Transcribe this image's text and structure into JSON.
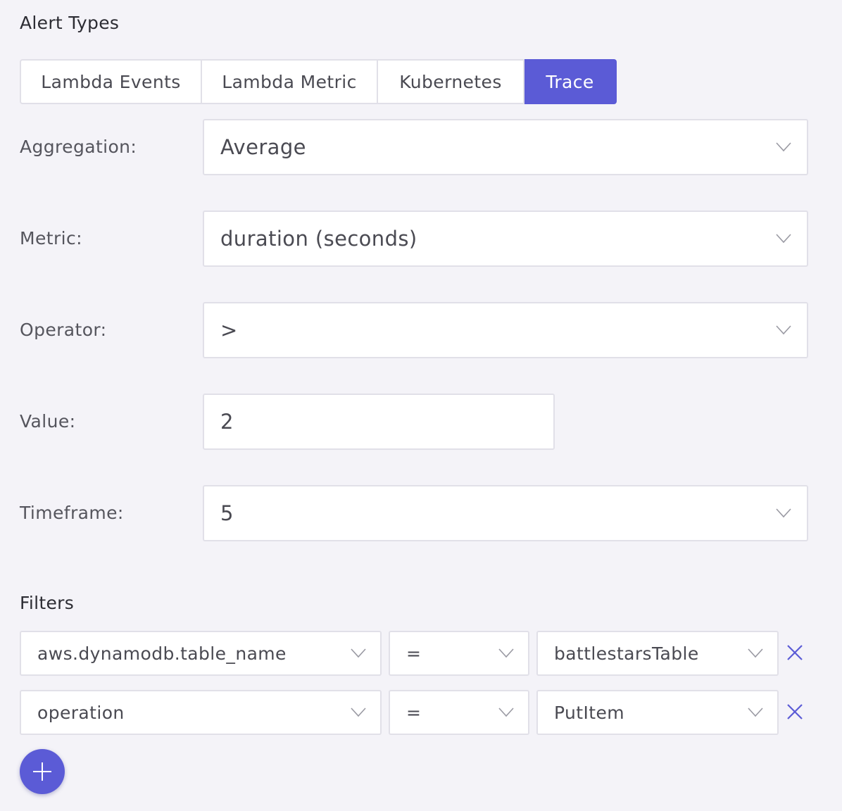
{
  "alert_types": {
    "title": "Alert Types",
    "tabs": [
      {
        "label": "Lambda Events",
        "active": false
      },
      {
        "label": "Lambda Metric",
        "active": false
      },
      {
        "label": "Kubernetes",
        "active": false
      },
      {
        "label": "Trace",
        "active": true
      }
    ]
  },
  "form": {
    "aggregation": {
      "label": "Aggregation:",
      "value": "Average"
    },
    "metric": {
      "label": "Metric:",
      "value": "duration (seconds)"
    },
    "operator": {
      "label": "Operator:",
      "value": ">"
    },
    "value": {
      "label": "Value:",
      "value": "2"
    },
    "timeframe": {
      "label": "Timeframe:",
      "value": "5"
    }
  },
  "filters": {
    "title": "Filters",
    "rows": [
      {
        "key": "aws.dynamodb.table_name",
        "operator": "=",
        "value": "battlestarsTable"
      },
      {
        "key": "operation",
        "operator": "=",
        "value": "PutItem"
      }
    ]
  },
  "icons": {
    "chevron": "chevron-down-icon",
    "remove": "close-icon",
    "add": "plus-icon"
  },
  "colors": {
    "accent": "#5b5bd6",
    "background": "#f4f3f8",
    "border": "#e1e0e8"
  }
}
